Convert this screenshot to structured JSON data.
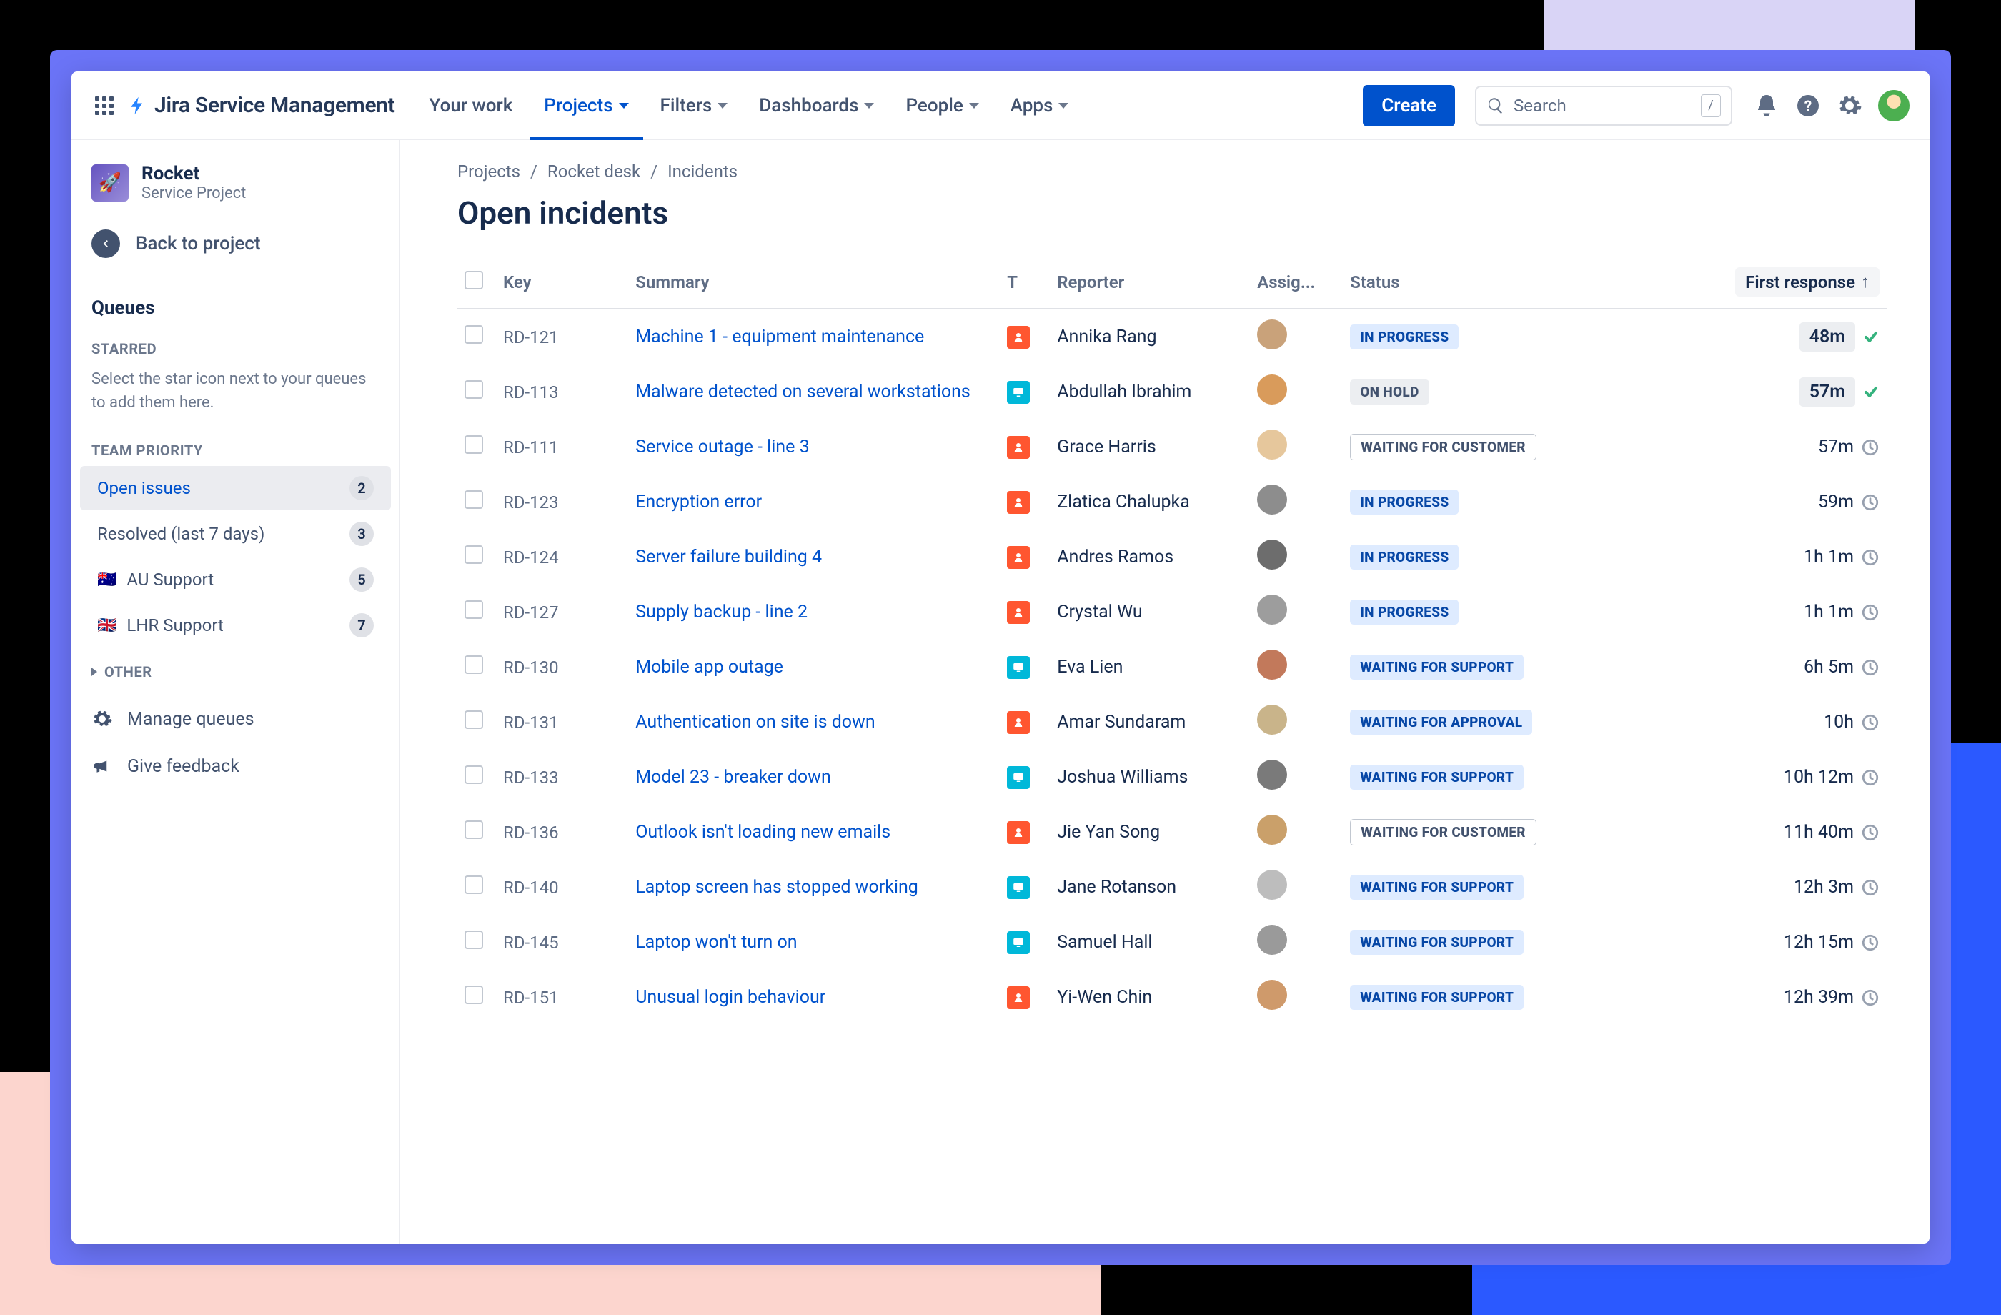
{
  "product_name": "Jira Service Management",
  "nav": {
    "your_work": "Your work",
    "projects": "Projects",
    "filters": "Filters",
    "dashboards": "Dashboards",
    "people": "People",
    "apps": "Apps",
    "create": "Create",
    "search_placeholder": "Search"
  },
  "project": {
    "name": "Rocket",
    "subtitle": "Service Project"
  },
  "back_label": "Back to project",
  "sidebar": {
    "queues_heading": "Queues",
    "starred_label": "STARRED",
    "starred_help": "Select the star icon next to your queues to add them here.",
    "team_label": "TEAM PRIORITY",
    "items": [
      {
        "label": "Open issues",
        "count": "2",
        "active": true
      },
      {
        "label": "Resolved (last 7 days)",
        "count": "3"
      },
      {
        "label": "AU Support",
        "count": "5",
        "flag": "🇦🇺"
      },
      {
        "label": "LHR Support",
        "count": "7",
        "flag": "🇬🇧"
      }
    ],
    "other_label": "OTHER",
    "manage": "Manage queues",
    "feedback": "Give feedback"
  },
  "breadcrumbs": [
    "Projects",
    "Rocket desk",
    "Incidents"
  ],
  "page_title": "Open incidents",
  "columns": {
    "key": "Key",
    "summary": "Summary",
    "type": "T",
    "reporter": "Reporter",
    "assignee": "Assig...",
    "status": "Status",
    "first_response": "First response"
  },
  "status_labels": {
    "inprog": "IN PROGRESS",
    "hold": "ON HOLD",
    "waitc": "WAITING FOR CUSTOMER",
    "waits": "WAITING FOR SUPPORT",
    "waita": "WAITING FOR APPROVAL"
  },
  "rows": [
    {
      "key": "RD-121",
      "summary": "Machine 1 - equipment maintenance",
      "type": "red",
      "reporter": "Annika Rang",
      "status": "inprog",
      "resp": "48m",
      "resp_kind": "ok",
      "ava": "#c9a27a"
    },
    {
      "key": "RD-113",
      "summary": "Malware detected on several workstations",
      "type": "blue",
      "reporter": "Abdullah Ibrahim",
      "status": "hold",
      "resp": "57m",
      "resp_kind": "ok",
      "ava": "#d99b5b"
    },
    {
      "key": "RD-111",
      "summary": "Service outage - line 3",
      "type": "red",
      "reporter": "Grace Harris",
      "status": "waitc",
      "resp": "57m",
      "resp_kind": "clock",
      "ava": "#e6c79c"
    },
    {
      "key": "RD-123",
      "summary": "Encryption error",
      "type": "red",
      "reporter": "Zlatica Chalupka",
      "status": "inprog",
      "resp": "59m",
      "resp_kind": "clock",
      "ava": "#8d8d8d"
    },
    {
      "key": "RD-124",
      "summary": "Server failure building 4",
      "type": "red",
      "reporter": "Andres Ramos",
      "status": "inprog",
      "resp": "1h 1m",
      "resp_kind": "clock",
      "ava": "#6d6d6d"
    },
    {
      "key": "RD-127",
      "summary": "Supply backup - line 2",
      "type": "red",
      "reporter": "Crystal Wu",
      "status": "inprog",
      "resp": "1h 1m",
      "resp_kind": "clock",
      "ava": "#9d9d9d"
    },
    {
      "key": "RD-130",
      "summary": "Mobile app outage",
      "type": "blue",
      "reporter": "Eva Lien",
      "status": "waits",
      "resp": "6h 5m",
      "resp_kind": "clock",
      "ava": "#c2795b"
    },
    {
      "key": "RD-131",
      "summary": "Authentication on site is down",
      "type": "red",
      "reporter": "Amar Sundaram",
      "status": "waita",
      "resp": "10h",
      "resp_kind": "clock",
      "ava": "#c9b48a"
    },
    {
      "key": "RD-133",
      "summary": "Model 23 - breaker down",
      "type": "blue",
      "reporter": "Joshua Williams",
      "status": "waits",
      "resp": "10h 12m",
      "resp_kind": "clock",
      "ava": "#7a7a7a"
    },
    {
      "key": "RD-136",
      "summary": "Outlook isn't loading new emails",
      "type": "red",
      "reporter": "Jie Yan Song",
      "status": "waitc",
      "resp": "11h 40m",
      "resp_kind": "clock",
      "ava": "#caa06a"
    },
    {
      "key": "RD-140",
      "summary": "Laptop screen has stopped working",
      "type": "blue",
      "reporter": "Jane Rotanson",
      "status": "waits",
      "resp": "12h 3m",
      "resp_kind": "clock",
      "ava": "#bdbdbd"
    },
    {
      "key": "RD-145",
      "summary": "Laptop won't turn on",
      "type": "blue",
      "reporter": "Samuel Hall",
      "status": "waits",
      "resp": "12h 15m",
      "resp_kind": "clock",
      "ava": "#9a9a9a"
    },
    {
      "key": "RD-151",
      "summary": "Unusual login behaviour",
      "type": "red",
      "reporter": "Yi-Wen Chin",
      "status": "waits",
      "resp": "12h 39m",
      "resp_kind": "clock",
      "ava": "#cf9a6b"
    }
  ]
}
